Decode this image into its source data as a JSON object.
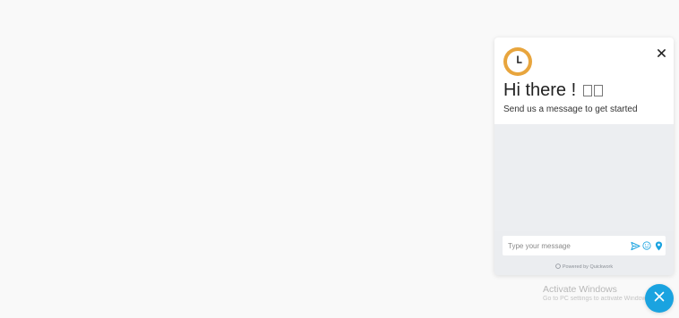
{
  "chat": {
    "greeting": "Hi there !",
    "subtitle": "Send us a message to get started",
    "input_placeholder": "Type your message",
    "powered_by": "Powered by Quickwork"
  },
  "os_watermark": {
    "title": "Activate Windows",
    "subtitle": "Go to PC settings to activate Windows."
  },
  "colors": {
    "accent": "#1aa3e0",
    "logo": "#e8a53d",
    "chat_body": "#eceef1"
  },
  "icons": {
    "logo": "clock-icon",
    "close": "close-icon",
    "emoji_placeholder": "missing-glyph-icon",
    "send": "send-icon",
    "emoji": "emoji-icon",
    "location": "location-pin-icon",
    "powered": "quickwork-logo-icon",
    "fab": "close-icon"
  }
}
